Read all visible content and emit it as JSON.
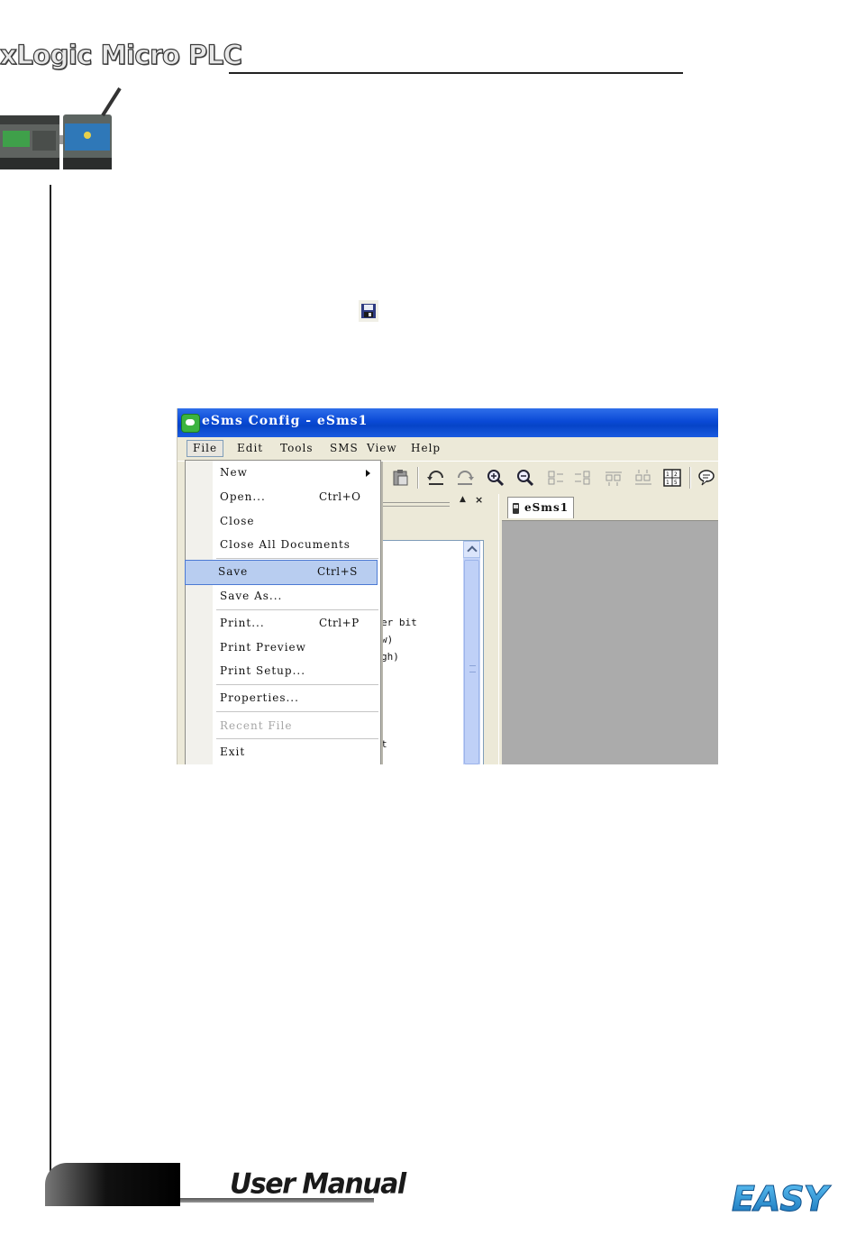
{
  "header": {
    "title": "xLogic Micro PLC"
  },
  "window": {
    "title": "eSms Config - eSms1",
    "menus": [
      "File",
      "Edit",
      "Tools",
      "SMS",
      "View",
      "Help"
    ],
    "tab_label": "eSms1",
    "tree_fragments": [
      "er bit",
      "w)",
      "gh)",
      "t"
    ]
  },
  "file_menu": {
    "items": [
      {
        "label": "New",
        "shortcut": ""
      },
      {
        "label": "Open...",
        "shortcut": "Ctrl+O"
      },
      {
        "label": "Close",
        "shortcut": ""
      },
      {
        "label": "Close All Documents",
        "shortcut": ""
      },
      {
        "label": "Save",
        "shortcut": "Ctrl+S"
      },
      {
        "label": "Save As...",
        "shortcut": ""
      },
      {
        "label": "Print...",
        "shortcut": "Ctrl+P"
      },
      {
        "label": "Print Preview",
        "shortcut": ""
      },
      {
        "label": "Print Setup...",
        "shortcut": ""
      },
      {
        "label": "Properties...",
        "shortcut": ""
      },
      {
        "label": "Recent File",
        "shortcut": ""
      },
      {
        "label": "Exit",
        "shortcut": ""
      }
    ],
    "selected": "Save",
    "disabled": [
      "Recent File"
    ]
  },
  "footer": {
    "title": "User Manual",
    "logo_text": "EASY"
  },
  "colors": {
    "titlebar": "#0a49d6",
    "selection": "#b8cdf0",
    "logo": "#1f8fd6"
  }
}
